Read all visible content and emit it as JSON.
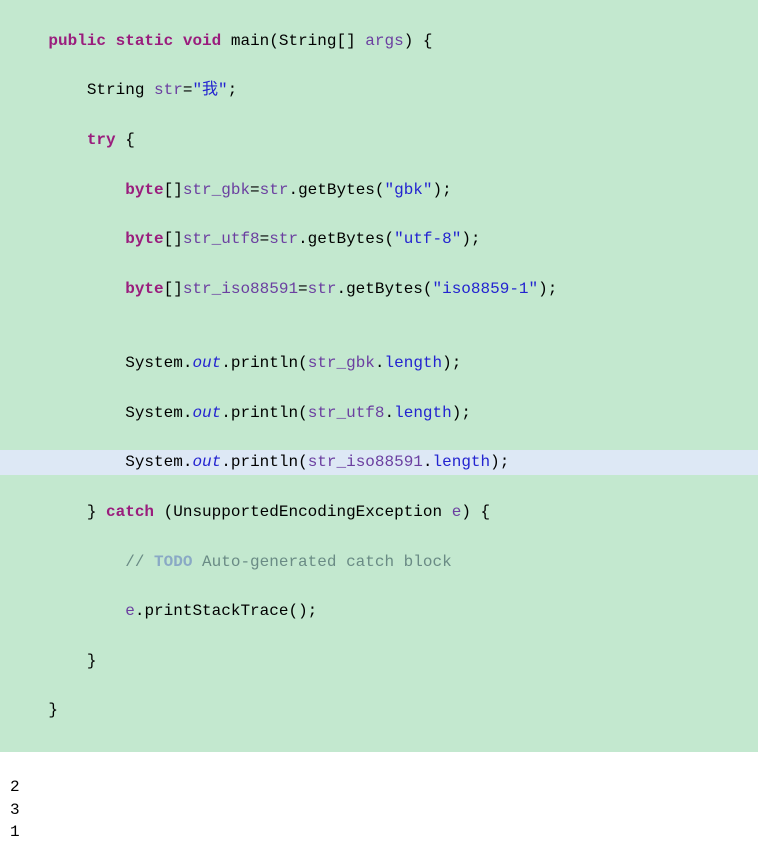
{
  "code": {
    "l1": {
      "kw_public": "public",
      "kw_static": "static",
      "kw_void": "void",
      "main": "main",
      "p_open": "(",
      "argtype": "String",
      "brackets": "[]",
      "argname": "args",
      "p_close": ")",
      "brace": " {"
    },
    "l2": {
      "indent": "        ",
      "type": "String",
      "var": "str",
      "eq": "=",
      "val": "\"我\"",
      "semi": ";"
    },
    "l3": {
      "indent": "        ",
      "kw_try": "try",
      "brace": " {"
    },
    "l4": {
      "indent": "            ",
      "kw_byte": "byte",
      "brackets": "[]",
      "var": "str_gbk",
      "eq": "=",
      "obj": "str",
      "dot": ".",
      "method": "getBytes",
      "p_open": "(",
      "arg": "\"gbk\"",
      "p_close": ")",
      "semi": ";"
    },
    "l5": {
      "indent": "            ",
      "kw_byte": "byte",
      "brackets": "[]",
      "var": "str_utf8",
      "eq": "=",
      "obj": "str",
      "dot": ".",
      "method": "getBytes",
      "p_open": "(",
      "arg": "\"utf-8\"",
      "p_close": ")",
      "semi": ";"
    },
    "l6": {
      "indent": "            ",
      "kw_byte": "byte",
      "brackets": "[]",
      "var": "str_iso88591",
      "eq": "=",
      "obj": "str",
      "dot": ".",
      "method": "getBytes",
      "p_open": "(",
      "arg": "\"iso8859-1\"",
      "p_close": ")",
      "semi": ";"
    },
    "l7": {
      "blank": ""
    },
    "l8": {
      "indent": "            ",
      "sys": "System",
      "dot1": ".",
      "out": "out",
      "dot2": ".",
      "println": "println",
      "p_open": "(",
      "var": "str_gbk",
      "dot3": ".",
      "len": "length",
      "p_close": ")",
      "semi": ";"
    },
    "l9": {
      "indent": "            ",
      "sys": "System",
      "dot1": ".",
      "out": "out",
      "dot2": ".",
      "println": "println",
      "p_open": "(",
      "var": "str_utf8",
      "dot3": ".",
      "len": "length",
      "p_close": ")",
      "semi": ";"
    },
    "l10": {
      "indent": "            ",
      "sys": "System",
      "dot1": ".",
      "out": "out",
      "dot2": ".",
      "println": "println",
      "p_open": "(",
      "var": "str_iso88591",
      "dot3": ".",
      "len": "length",
      "p_close": ")",
      "semi": ";"
    },
    "l11": {
      "indent": "        ",
      "brace_close": "}",
      "kw_catch": " catch ",
      "p_open": "(",
      "exc": "UnsupportedEncodingException",
      "sp": " ",
      "e": "e",
      "p_close": ")",
      "brace": " {"
    },
    "l12": {
      "indent": "            ",
      "slashes": "// ",
      "todo": "TODO",
      "rest": " Auto-generated catch block"
    },
    "l13": {
      "indent": "            ",
      "e": "e",
      "dot": ".",
      "method": "printStackTrace",
      "parens": "()",
      "semi": ";"
    },
    "l14": {
      "indent": "        ",
      "brace": "}"
    },
    "l15": {
      "indent": "    ",
      "brace": "}"
    }
  },
  "output": {
    "line1": "2",
    "line2": "3",
    "line3": "1"
  }
}
